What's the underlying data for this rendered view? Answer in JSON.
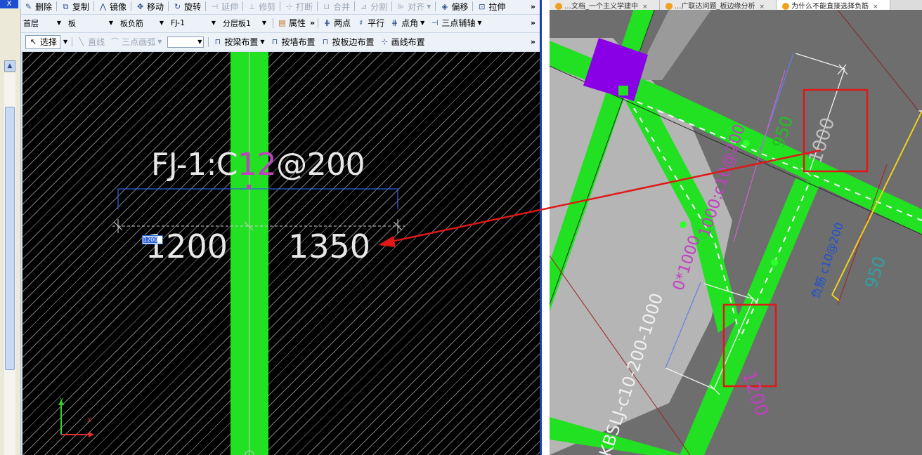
{
  "left_window": {
    "close_glyph": "X",
    "toolbar_row1": [
      {
        "label": "删除",
        "icon": "eraser-icon",
        "glyph": "✎",
        "disabled": false
      },
      {
        "label": "复制",
        "icon": "copy-icon",
        "glyph": "⧉",
        "disabled": false
      },
      {
        "label": "镜像",
        "icon": "mirror-icon",
        "glyph": "⋀",
        "disabled": false
      },
      {
        "label": "移动",
        "icon": "move-icon",
        "glyph": "✥",
        "disabled": false
      },
      {
        "label": "旋转",
        "icon": "rotate-icon",
        "glyph": "↻",
        "disabled": false
      },
      {
        "label": "延伸",
        "icon": "extend-icon",
        "glyph": "⊣",
        "disabled": true
      },
      {
        "label": "修剪",
        "icon": "trim-icon",
        "glyph": "⊥",
        "disabled": true
      },
      {
        "label": "打断",
        "icon": "break-icon",
        "glyph": "⊹",
        "disabled": true
      },
      {
        "label": "合并",
        "icon": "merge-icon",
        "glyph": "⊔",
        "disabled": true
      },
      {
        "label": "分割",
        "icon": "split-icon",
        "glyph": "⊿",
        "disabled": true
      },
      {
        "label": "对齐",
        "icon": "align-icon",
        "glyph": "⊫",
        "disabled": true,
        "dropdown": true
      },
      {
        "label": "偏移",
        "icon": "offset-icon",
        "glyph": "◈",
        "disabled": false
      },
      {
        "label": "拉伸",
        "icon": "stretch-icon",
        "glyph": "⊡",
        "disabled": false
      }
    ],
    "toolbar_row2": {
      "selects": [
        {
          "value": "首层",
          "name": "floor-select"
        },
        {
          "value": "板",
          "name": "component-type-select"
        },
        {
          "value": "板负筋",
          "name": "subtype-select"
        },
        {
          "value": "FJ-1",
          "name": "component-select"
        },
        {
          "value": "分层板1",
          "name": "layer-select"
        }
      ],
      "property_label": "属性",
      "tools": [
        {
          "label": "两点",
          "icon": "two-point-icon",
          "glyph": "⋕"
        },
        {
          "label": "平行",
          "icon": "parallel-icon",
          "glyph": "♯"
        },
        {
          "label": "点角",
          "icon": "point-angle-icon",
          "glyph": "⋕",
          "dropdown": true
        },
        {
          "label": "三点辅轴",
          "icon": "three-point-axis-icon",
          "glyph": "⊣",
          "dropdown": true
        }
      ]
    },
    "toolbar_row3": {
      "select_label": "选择",
      "line_label": "直线",
      "arc_label": "三点画弧",
      "buttons": [
        {
          "label": "按梁布置",
          "icon": "by-beam-icon",
          "glyph": "⊓",
          "dropdown": true
        },
        {
          "label": "按墙布置",
          "icon": "by-wall-icon",
          "glyph": "⊓"
        },
        {
          "label": "按板边布置",
          "icon": "by-slab-edge-icon",
          "glyph": "⊓"
        },
        {
          "label": "画线布置",
          "icon": "draw-line-icon",
          "glyph": "⊹"
        }
      ]
    },
    "more_glyph": "»",
    "scroll_up_glyph": "▲",
    "canvas": {
      "rebar_label_prefix": "FJ-1:C",
      "rebar_label_highlight": "12",
      "rebar_label_suffix": "@200",
      "dimension_left": "1200",
      "dimension_right": "1350",
      "input_value": "1200",
      "axis_x": "X",
      "axis_y": "Y"
    }
  },
  "right_window": {
    "tabs": [
      {
        "label": "…文档_一个主义学建中",
        "active": false
      },
      {
        "label": "…广联达问题_板边缘分析",
        "active": false
      },
      {
        "label": "为什么不能直接选择负筋",
        "active": true
      }
    ],
    "canvas": {
      "dim_1000": "1000",
      "dim_950_top": "950",
      "dim_1200": "1200",
      "dim_950_right": "950",
      "rebar_text": "1000:c10@200",
      "rebar_text_2": "0*1000",
      "long_label": "KBSLJ-c10-200-1000",
      "right_label": "负筋 c10@200"
    }
  },
  "colors": {
    "green": "#22e022",
    "magenta": "#c040c0",
    "annotation_red": "#e01818",
    "purple_block": "#8a00e6",
    "dim_blue": "#3060e0"
  }
}
